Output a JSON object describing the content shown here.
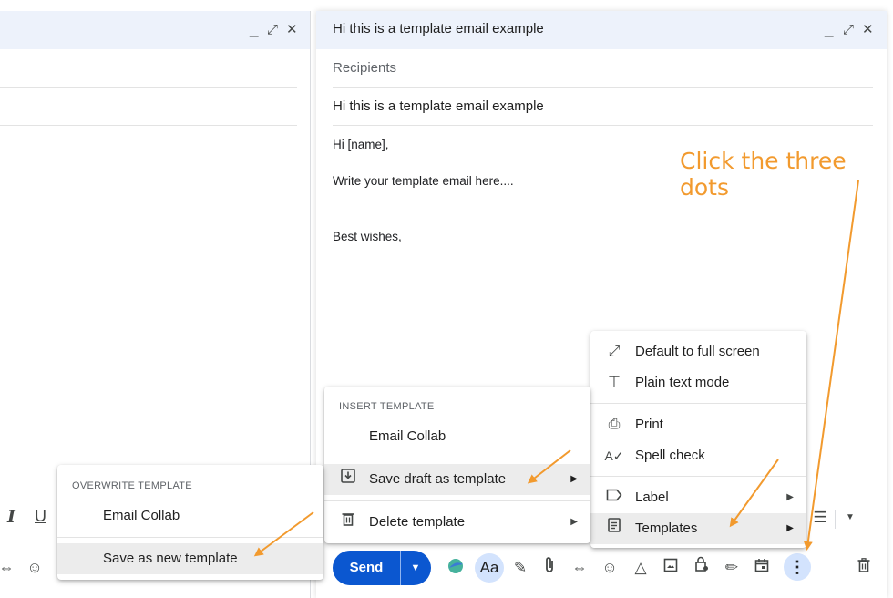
{
  "left_window": {
    "controls": {
      "minimize": "_",
      "expand": "⤢",
      "close": "✕"
    }
  },
  "compose": {
    "title": "Hi this is a template email example",
    "controls": {
      "minimize": "_",
      "expand": "⤢",
      "close": "✕"
    },
    "recipients_placeholder": "Recipients",
    "subject": "Hi this is a template email example",
    "body": {
      "greeting": "Hi [name],",
      "line": "Write your template email here....",
      "signoff": "Best wishes,"
    }
  },
  "annotation": "Click the three dots",
  "toolbar": {
    "send_label": "Send",
    "send_dropdown": "▼",
    "format_label": "Aa",
    "more_label": "⋮"
  },
  "more_menu": {
    "items": [
      {
        "label": "Default to full screen",
        "icon": "expand-diagonal-icon"
      },
      {
        "label": "Plain text mode",
        "icon": "clear-format-icon"
      },
      {
        "label": "Print",
        "icon": "printer-icon"
      },
      {
        "label": "Spell check",
        "icon": "spellcheck-icon"
      },
      {
        "label": "Label",
        "icon": "label-icon"
      },
      {
        "label": "Templates",
        "icon": "template-icon"
      }
    ]
  },
  "templates_menu": {
    "header": "INSERT TEMPLATE",
    "items": [
      {
        "label": "Email Collab"
      },
      {
        "label": "Save draft as template",
        "icon": "save-down-icon"
      },
      {
        "label": "Delete template",
        "icon": "trash-icon"
      }
    ]
  },
  "overwrite_menu": {
    "header": "OVERWRITE TEMPLATE",
    "items": [
      {
        "label": "Email Collab"
      },
      {
        "label": "Save as new template"
      }
    ]
  },
  "colors": {
    "accent": "#0b57d0",
    "header_bg": "#edf2fb",
    "annotation": "#f29a2e",
    "highlight": "#ececec"
  }
}
